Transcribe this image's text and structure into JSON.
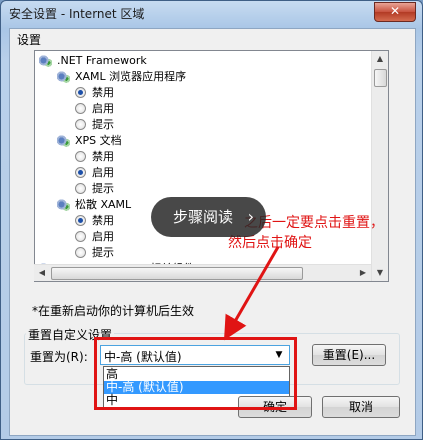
{
  "window": {
    "title": "安全设置 - Internet 区域",
    "close_label": "✕"
  },
  "settings_group": {
    "label": "设置"
  },
  "tree": [
    {
      "kind": "group",
      "label": ".NET Framework",
      "indent": 0,
      "icon": "settings-gear-icon"
    },
    {
      "kind": "group",
      "label": "XAML 浏览器应用程序",
      "indent": 1,
      "icon": "settings-gear-icon"
    },
    {
      "kind": "radio",
      "label": "禁用",
      "indent": 2,
      "checked": true
    },
    {
      "kind": "radio",
      "label": "启用",
      "indent": 2,
      "checked": false
    },
    {
      "kind": "radio",
      "label": "提示",
      "indent": 2,
      "checked": false
    },
    {
      "kind": "group",
      "label": "XPS 文档",
      "indent": 1,
      "icon": "settings-gear-icon"
    },
    {
      "kind": "radio",
      "label": "禁用",
      "indent": 2,
      "checked": false
    },
    {
      "kind": "radio",
      "label": "启用",
      "indent": 2,
      "checked": true
    },
    {
      "kind": "radio",
      "label": "提示",
      "indent": 2,
      "checked": false
    },
    {
      "kind": "group",
      "label": "松散 XAML",
      "indent": 1,
      "icon": "settings-gear-icon"
    },
    {
      "kind": "radio",
      "label": "禁用",
      "indent": 2,
      "checked": true
    },
    {
      "kind": "radio",
      "label": "启用",
      "indent": 2,
      "checked": false
    },
    {
      "kind": "radio",
      "label": "提示",
      "indent": 2,
      "checked": false
    },
    {
      "kind": "group",
      "label": ".NET Framework 相关组件",
      "indent": 0,
      "icon": "settings-gear-icon"
    }
  ],
  "note": "*在重新启动你的计算机后生效",
  "reset_group": {
    "label": "重置自定义设置",
    "reset_to_label": "重置为(R):",
    "selected": "中-高 (默认值)",
    "reset_button": "重置(E)...",
    "options": [
      {
        "label": "高",
        "selected": false
      },
      {
        "label": "中-高 (默认值)",
        "selected": true
      },
      {
        "label": "中",
        "selected": false
      }
    ]
  },
  "buttons": {
    "ok": "确定",
    "cancel": "取消"
  },
  "overlay": {
    "label": "步骤阅读",
    "chevron": "›"
  },
  "annotation": {
    "line1": "之后一定要点击重置，",
    "line2": "然后点击确定",
    "color": "#e01414"
  }
}
